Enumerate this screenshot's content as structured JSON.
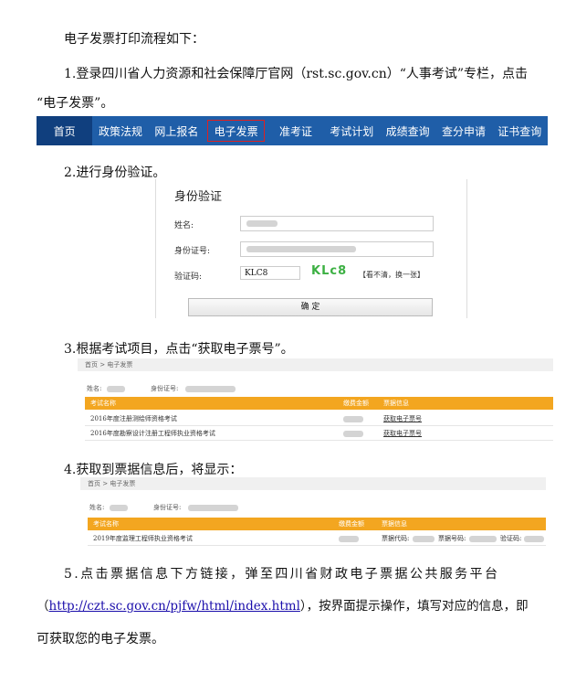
{
  "heading": "电子发票打印流程如下：",
  "step1": {
    "text": "1.登录四川省人力资源和社会保障厅官网（rst.sc.gov.cn）“人事考试”专栏，点击",
    "text2": "“电子发票”。"
  },
  "nav": {
    "items": [
      "首页",
      "政策法规",
      "网上报名",
      "电子发票",
      "准考证",
      "考试计划",
      "成绩查询",
      "查分申请",
      "证书查询"
    ]
  },
  "step2": {
    "text": "2.进行身份验证。",
    "title": "身份验证",
    "name_label": "姓名:",
    "id_label": "身份证号:",
    "captcha_label": "验证码:",
    "captcha_value": "KLC8",
    "captcha_image": "KLc8",
    "refresh": "【看不清，换一张】",
    "confirm": "确 定"
  },
  "step3": {
    "text": "3.根据考试项目，点击“获取电子票号”。",
    "crumb": "首页  >  电子发票",
    "name_label": "姓名:",
    "id_label": "身份证号:",
    "col_exam": "考试名称",
    "col_fee": "缴费金额",
    "col_bill": "票据信息",
    "rows": [
      {
        "exam": "2016年度注册测绘师资格考试",
        "link": "获取电子票号"
      },
      {
        "exam": "2016年度勘察设计注册工程师执业资格考试",
        "link": "获取电子票号"
      }
    ]
  },
  "step4": {
    "text": "4.获取到票据信息后，将显示：",
    "crumb": "首页  >  电子发票",
    "name_label": "姓名:",
    "id_label": "身份证号:",
    "col_exam": "考试名称",
    "col_fee": "缴费金额",
    "col_bill": "票据信息",
    "row_exam": "2019年度监理工程师执业资格考试",
    "bill_code": "票据代码:",
    "bill_no": "票据号码:",
    "verify_code": "验证码:"
  },
  "step5": {
    "text": "5.点击票据信息下方链接，弹至四川省财政电子票据公共服务平台",
    "paren_open": "（",
    "url": "http://czt.sc.gov.cn/pjfw/html/index.html",
    "text_after": "），按界面提示操作，填写对应的信息，即",
    "text3": "可获取您的电子发票。"
  }
}
